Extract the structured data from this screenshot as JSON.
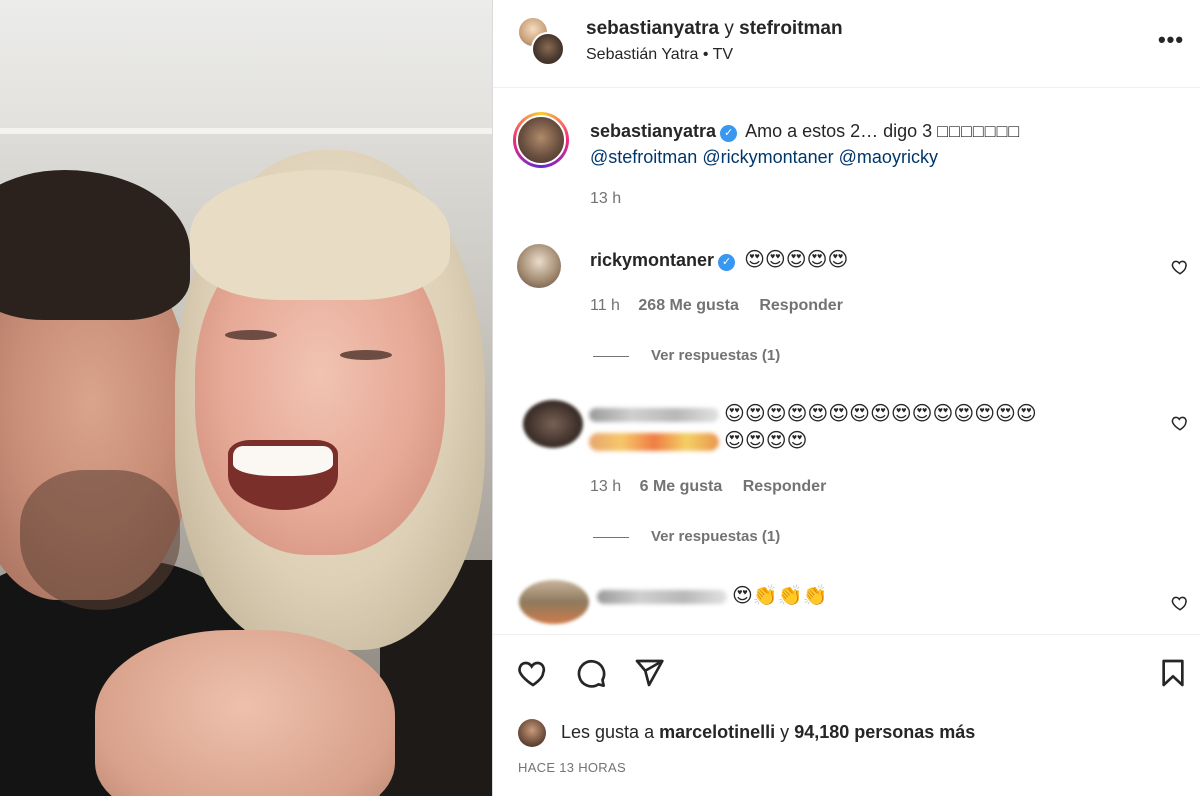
{
  "header": {
    "user_a": "sebastianyatra",
    "joiner": "y",
    "user_b": "stefroitman",
    "subtitle": "Sebastián Yatra • TV"
  },
  "caption": {
    "username": "sebastianyatra",
    "text": "Amo a estos 2… digo 3 ",
    "boxes": "□□□□□□□",
    "mentions": [
      "@stefroitman",
      "@rickymontaner",
      "@maoyricky"
    ],
    "time": "13 h"
  },
  "comments": [
    {
      "username": "rickymontaner",
      "verified": true,
      "text": "😍😍😍😍😍",
      "time": "11 h",
      "likes": "268 Me gusta",
      "reply": "Responder",
      "view_replies": "Ver respuestas (1)"
    },
    {
      "username": "",
      "verified": false,
      "text_line1": "😍😍😍😍😍😍😍😍😍😍😍😍😍😍😍",
      "text_line2": "😍😍😍😍",
      "time": "13 h",
      "likes": "6 Me gusta",
      "reply": "Responder",
      "view_replies": "Ver respuestas (1)"
    },
    {
      "username": "",
      "verified": false,
      "text": "😍👏👏👏"
    }
  ],
  "likes": {
    "prefix": "Les gusta a",
    "user": "marcelotinelli",
    "joiner": "y",
    "count": "94,180 personas más"
  },
  "post_age": "HACE 13 HORAS",
  "icons": {
    "like": "heart-icon",
    "comment": "comment-bubble-icon",
    "share": "paper-plane-icon",
    "save": "bookmark-icon",
    "more": "more-options-icon"
  },
  "colors": {
    "verified": "#3897f0",
    "mention": "#00376b",
    "muted": "#737373"
  }
}
